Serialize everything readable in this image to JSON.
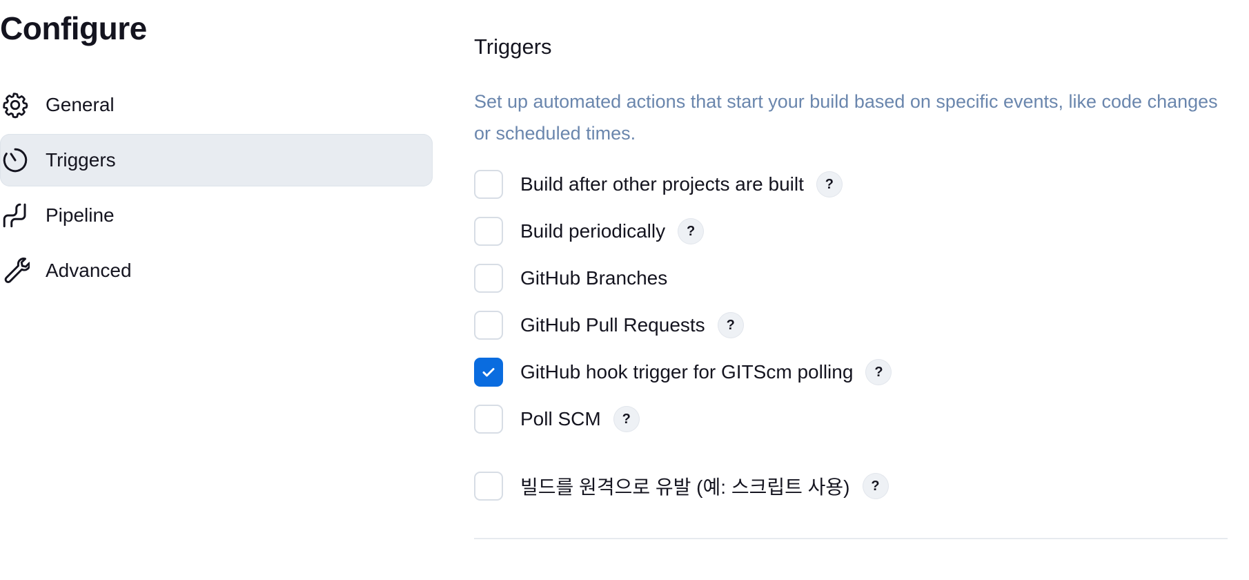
{
  "page": {
    "title": "Configure"
  },
  "sidebar": {
    "items": [
      {
        "label": "General",
        "icon": "gear-icon",
        "active": false
      },
      {
        "label": "Triggers",
        "icon": "clock-icon",
        "active": true
      },
      {
        "label": "Pipeline",
        "icon": "pipeline-icon",
        "active": false
      },
      {
        "label": "Advanced",
        "icon": "wrench-icon",
        "active": false
      }
    ]
  },
  "section": {
    "title": "Triggers",
    "description": "Set up automated actions that start your build based on specific events, like code changes or scheduled times."
  },
  "triggers": [
    {
      "label": "Build after other projects are built",
      "checked": false,
      "help": "?"
    },
    {
      "label": "Build periodically",
      "checked": false,
      "help": "?"
    },
    {
      "label": "GitHub Branches",
      "checked": false,
      "help": null
    },
    {
      "label": "GitHub Pull Requests",
      "checked": false,
      "help": "?"
    },
    {
      "label": "GitHub hook trigger for GITScm polling",
      "checked": true,
      "help": "?"
    },
    {
      "label": "Poll SCM",
      "checked": false,
      "help": "?"
    },
    {
      "label": "빌드를 원격으로 유발 (예: 스크립트 사용)",
      "checked": false,
      "help": "?"
    }
  ],
  "colors": {
    "accent": "#0a6cdf",
    "description_text": "#6a86ad",
    "active_nav_bg": "#e8ecf1",
    "checkbox_border": "#d7dde5"
  }
}
